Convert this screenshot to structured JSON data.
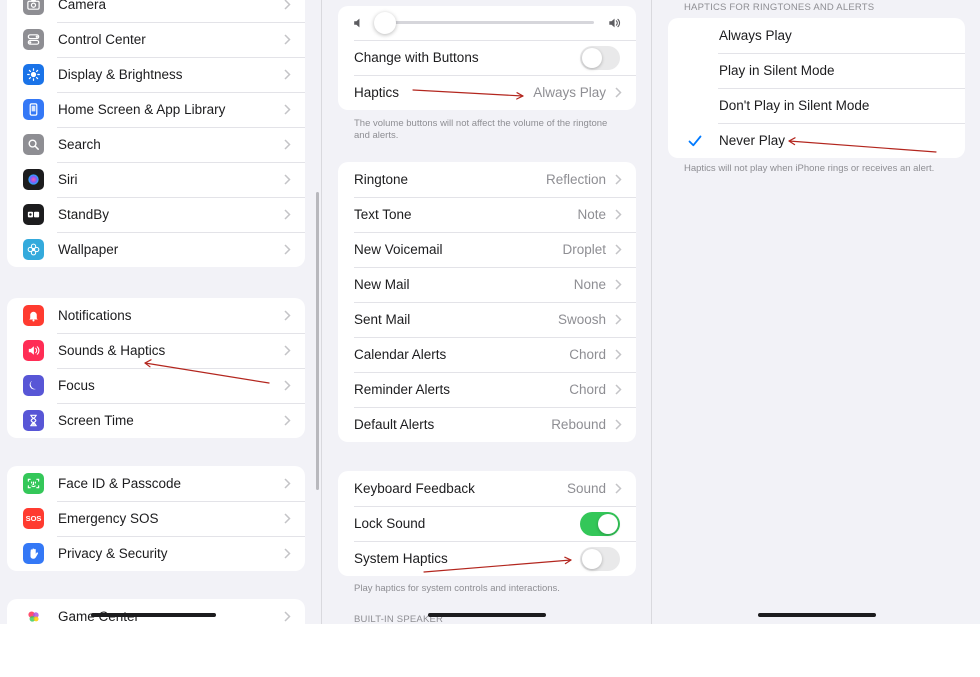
{
  "left_pane": {
    "groups": [
      [
        {
          "label": "Camera",
          "icon": "camera-icon",
          "color": "#8e8e93"
        },
        {
          "label": "Control Center",
          "icon": "control-center-icon",
          "color": "#8e8e93"
        },
        {
          "label": "Display & Brightness",
          "icon": "sun-icon",
          "color": "#1a73e8"
        },
        {
          "label": "Home Screen & App Library",
          "icon": "home-screen-icon",
          "color": "#3478f6"
        },
        {
          "label": "Search",
          "icon": "search-icon",
          "color": "#8e8e93"
        },
        {
          "label": "Siri",
          "icon": "siri-icon",
          "color": "#1c1c1e"
        },
        {
          "label": "StandBy",
          "icon": "standby-icon",
          "color": "#1c1c1e"
        },
        {
          "label": "Wallpaper",
          "icon": "flower-icon",
          "color": "#34aadc"
        }
      ],
      [
        {
          "label": "Notifications",
          "icon": "bell-icon",
          "color": "#ff3b30"
        },
        {
          "label": "Sounds & Haptics",
          "icon": "speaker-icon",
          "color": "#ff2d55"
        },
        {
          "label": "Focus",
          "icon": "moon-icon",
          "color": "#5856d6"
        },
        {
          "label": "Screen Time",
          "icon": "hourglass-icon",
          "color": "#5856d6"
        }
      ],
      [
        {
          "label": "Face ID & Passcode",
          "icon": "face-id-icon",
          "color": "#34c759"
        },
        {
          "label": "Emergency SOS",
          "icon": "sos-icon",
          "color": "#ff3b30",
          "text": "SOS"
        },
        {
          "label": "Privacy & Security",
          "icon": "hand-icon",
          "color": "#3478f6"
        }
      ],
      [
        {
          "label": "Game Center",
          "icon": "game-center-icon",
          "color": "#af52de"
        }
      ]
    ]
  },
  "middle_pane": {
    "volume": {
      "level": 0.04
    },
    "change_with_buttons": {
      "label": "Change with Buttons",
      "on": false
    },
    "haptics": {
      "label": "Haptics",
      "value": "Always Play"
    },
    "volume_note": "The volume buttons will not affect the volume of the ringtone and alerts.",
    "sounds": [
      {
        "label": "Ringtone",
        "value": "Reflection"
      },
      {
        "label": "Text Tone",
        "value": "Note"
      },
      {
        "label": "New Voicemail",
        "value": "Droplet"
      },
      {
        "label": "New Mail",
        "value": "None"
      },
      {
        "label": "Sent Mail",
        "value": "Swoosh"
      },
      {
        "label": "Calendar Alerts",
        "value": "Chord"
      },
      {
        "label": "Reminder Alerts",
        "value": "Chord"
      },
      {
        "label": "Default Alerts",
        "value": "Rebound"
      }
    ],
    "keyboard_feedback": {
      "label": "Keyboard Feedback",
      "value": "Sound"
    },
    "lock_sound": {
      "label": "Lock Sound",
      "on": true
    },
    "system_haptics": {
      "label": "System Haptics",
      "on": false
    },
    "system_haptics_note": "Play haptics for system controls and interactions.",
    "built_in_speaker_header": "BUILT-IN SPEAKER"
  },
  "right_pane": {
    "header": "HAPTICS FOR RINGTONES AND ALERTS",
    "options": [
      {
        "label": "Always Play",
        "selected": false
      },
      {
        "label": "Play in Silent Mode",
        "selected": false
      },
      {
        "label": "Don't Play in Silent Mode",
        "selected": false
      },
      {
        "label": "Never Play",
        "selected": true
      }
    ],
    "note": "Haptics will not play when iPhone rings or receives an alert."
  },
  "colors": {
    "accent": "#007aff",
    "toggle_on": "#34c759",
    "annotation_arrow": "#b3261e"
  }
}
